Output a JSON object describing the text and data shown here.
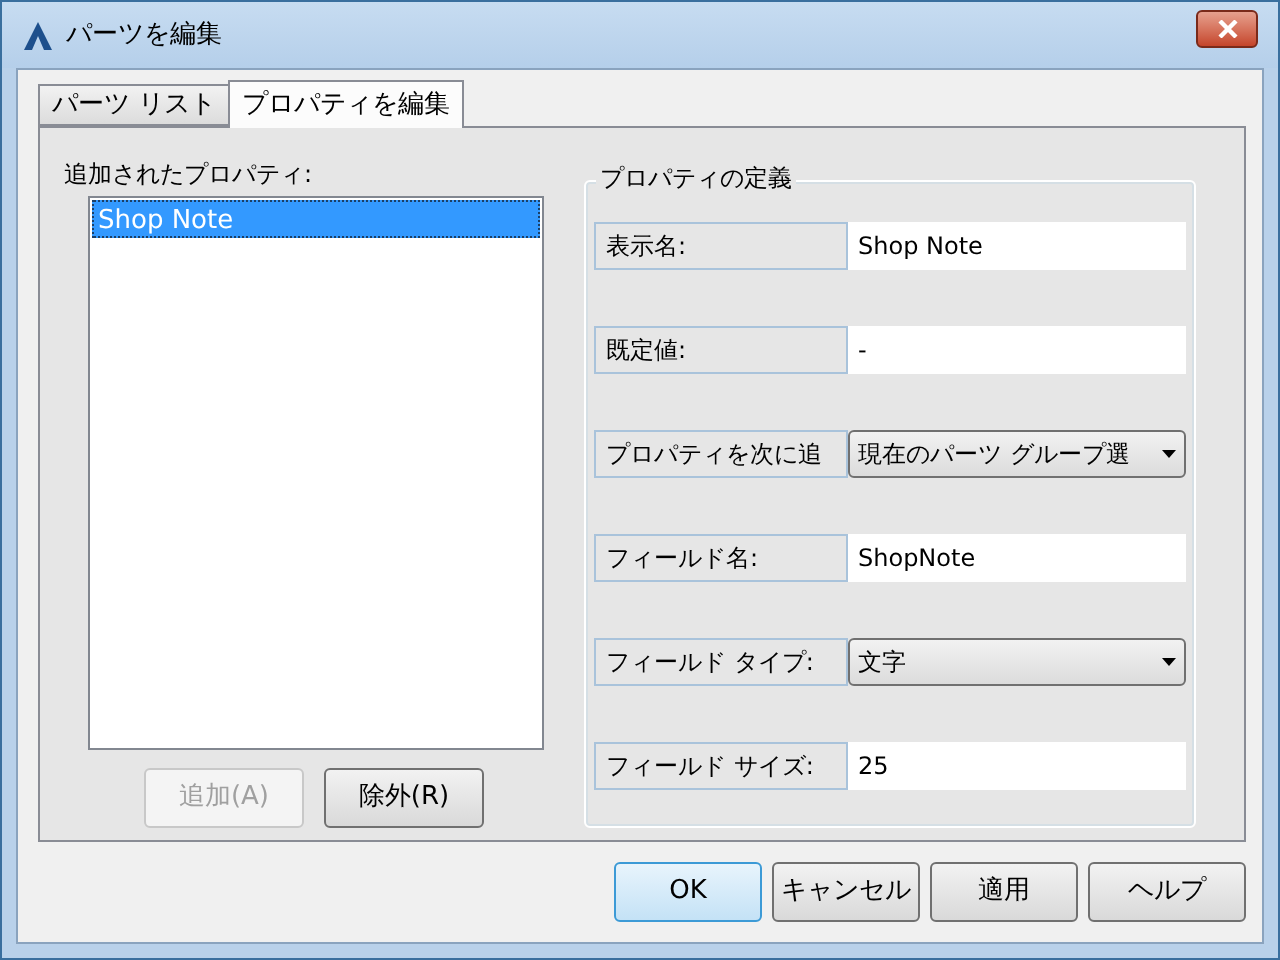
{
  "window": {
    "title": "パーツを編集"
  },
  "tabs": [
    {
      "label": "パーツ リスト",
      "selected": false
    },
    {
      "label": "プロパティを編集",
      "selected": true
    }
  ],
  "added_properties": {
    "label": "追加されたプロパティ:",
    "items": [
      {
        "label": "Shop Note",
        "selected": true
      }
    ],
    "buttons": [
      {
        "label": "追加(A)",
        "disabled": true
      },
      {
        "label": "除外(R)",
        "disabled": false
      }
    ]
  },
  "definition": {
    "title": "プロパティの定義",
    "rows": [
      {
        "kind": "text",
        "label": "表示名:",
        "value": "Shop Note"
      },
      {
        "kind": "text",
        "label": "既定値:",
        "value": "-"
      },
      {
        "kind": "dropdown",
        "label": "プロパティを次に追",
        "value": "現在のパーツ グループ選"
      },
      {
        "kind": "text",
        "label": "フィールド名:",
        "value": "ShopNote"
      },
      {
        "kind": "dropdown",
        "label": "フィールド タイプ:",
        "value": "文字"
      },
      {
        "kind": "text",
        "label": "フィールド サイズ:",
        "value": "25"
      }
    ]
  },
  "buttons": [
    {
      "label": "OK",
      "default": true
    },
    {
      "label": "キャンセル",
      "default": false
    },
    {
      "label": "適用",
      "default": false
    },
    {
      "label": "ヘルプ",
      "default": false
    }
  ]
}
